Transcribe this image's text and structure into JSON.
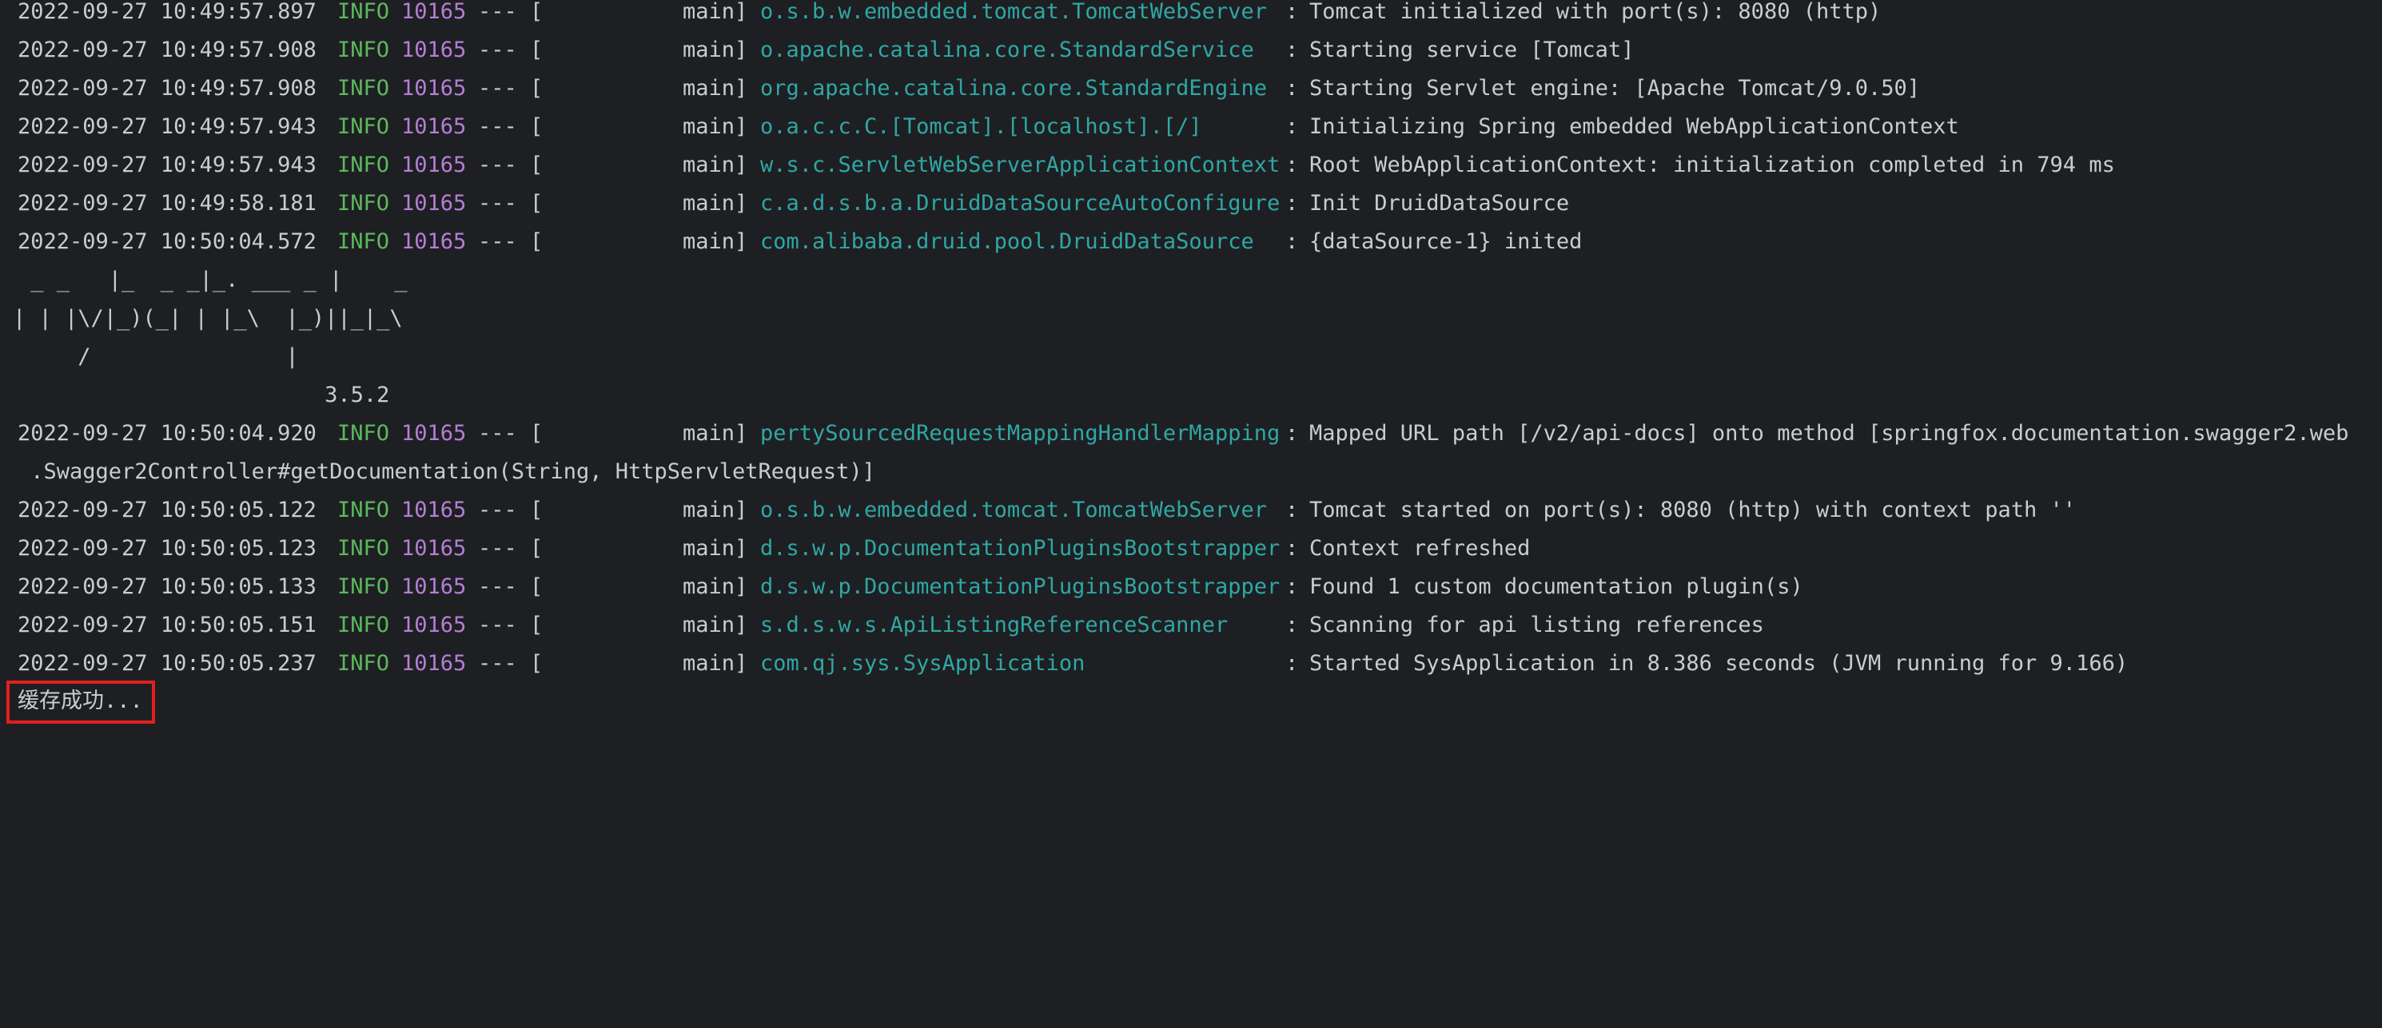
{
  "console": {
    "log_lines": [
      {
        "ts": "2022-09-27 10:49:57.897",
        "level": "INFO",
        "pid": "10165",
        "sep": "--- [",
        "thread": "main]",
        "logger": "o.s.b.w.embedded.tomcat.TomcatWebServer",
        "colon": ":",
        "message": "Tomcat initialized with port(s): 8080 (http)"
      },
      {
        "ts": "2022-09-27 10:49:57.908",
        "level": "INFO",
        "pid": "10165",
        "sep": "--- [",
        "thread": "main]",
        "logger": "o.apache.catalina.core.StandardService",
        "colon": ":",
        "message": "Starting service [Tomcat]"
      },
      {
        "ts": "2022-09-27 10:49:57.908",
        "level": "INFO",
        "pid": "10165",
        "sep": "--- [",
        "thread": "main]",
        "logger": "org.apache.catalina.core.StandardEngine",
        "colon": ":",
        "message": "Starting Servlet engine: [Apache Tomcat/9.0.50]"
      },
      {
        "ts": "2022-09-27 10:49:57.943",
        "level": "INFO",
        "pid": "10165",
        "sep": "--- [",
        "thread": "main]",
        "logger": "o.a.c.c.C.[Tomcat].[localhost].[/]",
        "colon": ":",
        "message": "Initializing Spring embedded WebApplicationContext"
      },
      {
        "ts": "2022-09-27 10:49:57.943",
        "level": "INFO",
        "pid": "10165",
        "sep": "--- [",
        "thread": "main]",
        "logger": "w.s.c.ServletWebServerApplicationContext",
        "colon": ":",
        "message": "Root WebApplicationContext: initialization completed in 794 ms"
      },
      {
        "ts": "2022-09-27 10:49:58.181",
        "level": "INFO",
        "pid": "10165",
        "sep": "--- [",
        "thread": "main]",
        "logger": "c.a.d.s.b.a.DruidDataSourceAutoConfigure",
        "colon": ":",
        "message": "Init DruidDataSource"
      },
      {
        "ts": "2022-09-27 10:50:04.572",
        "level": "INFO",
        "pid": "10165",
        "sep": "--- [",
        "thread": "main]",
        "logger": "com.alibaba.druid.pool.DruidDataSource",
        "colon": ":",
        "message": "{dataSource-1} inited"
      }
    ],
    "banner": [
      " _ _   |_  _ _|_. ___ _ |    _",
      "| | |\\/|_)(_| | |_\\  |_)||_|_\\",
      "     /               |",
      "                        3.5.2"
    ],
    "log_lines_2": [
      {
        "ts": "2022-09-27 10:50:04.920",
        "level": "INFO",
        "pid": "10165",
        "sep": "--- [",
        "thread": "main]",
        "logger": "pertySourcedRequestMappingHandlerMapping",
        "colon": ":",
        "message": "Mapped URL path [/v2/api-docs] onto method [springfox.documentation.swagger2.web"
      }
    ],
    "wrap_line": " .Swagger2Controller#getDocumentation(String, HttpServletRequest)]",
    "log_lines_3": [
      {
        "ts": "2022-09-27 10:50:05.122",
        "level": "INFO",
        "pid": "10165",
        "sep": "--- [",
        "thread": "main]",
        "logger": "o.s.b.w.embedded.tomcat.TomcatWebServer",
        "colon": ":",
        "message": "Tomcat started on port(s): 8080 (http) with context path ''"
      },
      {
        "ts": "2022-09-27 10:50:05.123",
        "level": "INFO",
        "pid": "10165",
        "sep": "--- [",
        "thread": "main]",
        "logger": "d.s.w.p.DocumentationPluginsBootstrapper",
        "colon": ":",
        "message": "Context refreshed"
      },
      {
        "ts": "2022-09-27 10:50:05.133",
        "level": "INFO",
        "pid": "10165",
        "sep": "--- [",
        "thread": "main]",
        "logger": "d.s.w.p.DocumentationPluginsBootstrapper",
        "colon": ":",
        "message": "Found 1 custom documentation plugin(s)"
      },
      {
        "ts": "2022-09-27 10:50:05.151",
        "level": "INFO",
        "pid": "10165",
        "sep": "--- [",
        "thread": "main]",
        "logger": "s.d.s.w.s.ApiListingReferenceScanner",
        "colon": ":",
        "message": "Scanning for api listing references"
      },
      {
        "ts": "2022-09-27 10:50:05.237",
        "level": "INFO",
        "pid": "10165",
        "sep": "--- [",
        "thread": "main]",
        "logger": "com.qj.sys.SysApplication",
        "colon": ":",
        "message": "Started SysApplication in 8.386 seconds (JVM running for 9.166)"
      }
    ],
    "cached_message": "缓存成功..."
  },
  "colors": {
    "background": "#1e1f22",
    "text": "#c9ccd2",
    "level_info": "#5cb85c",
    "pid": "#b37fd6",
    "logger": "#2fa7a5",
    "highlight_border": "#e02020"
  }
}
